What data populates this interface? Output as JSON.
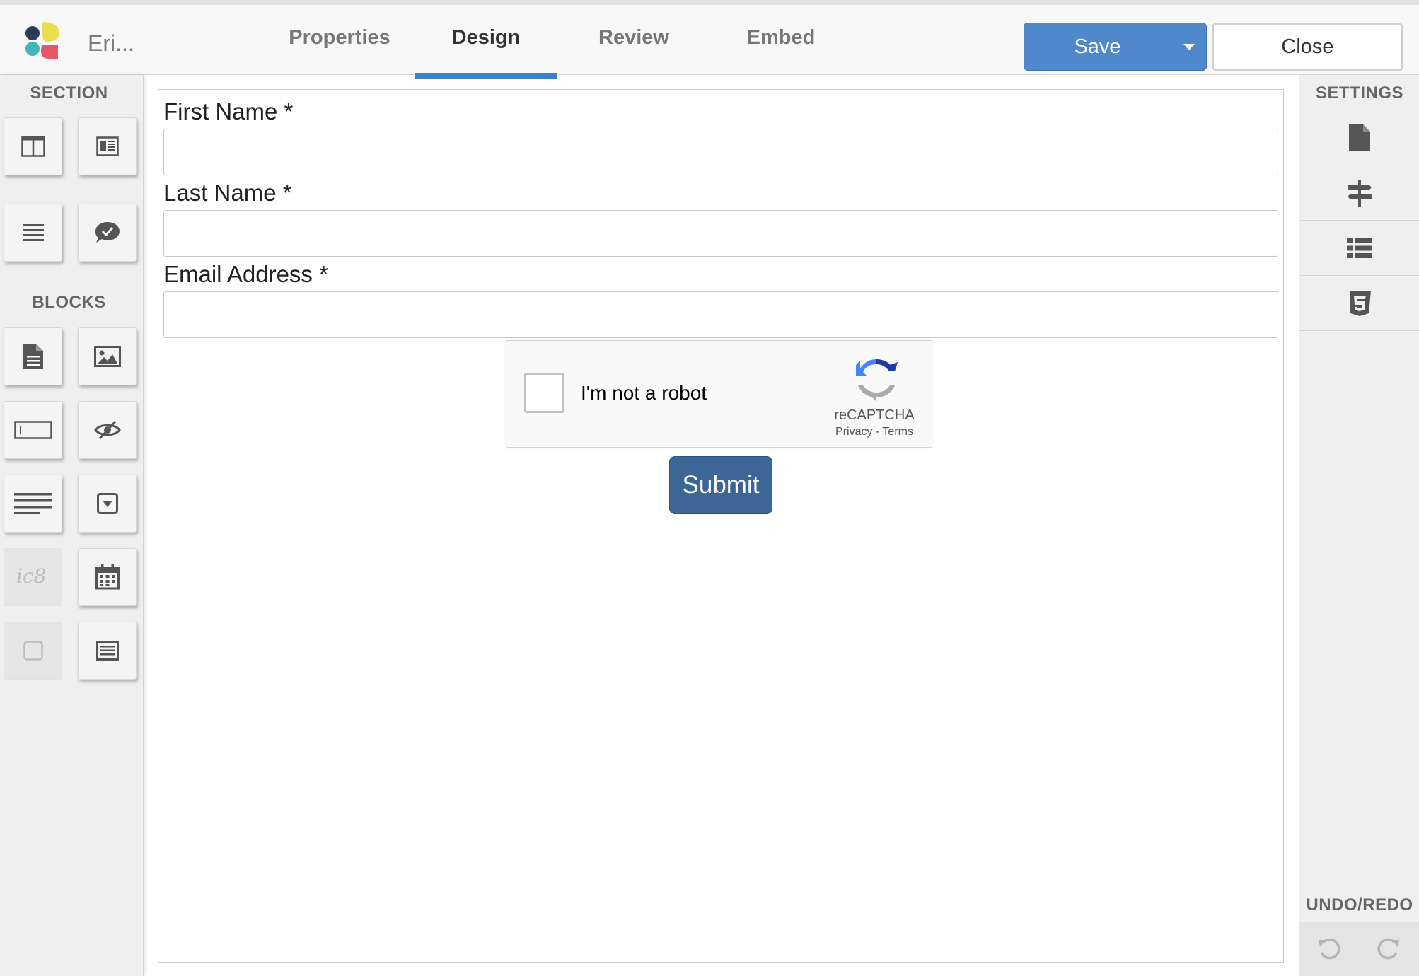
{
  "app": {
    "name": "Eri..."
  },
  "tabs": [
    {
      "label": "Properties",
      "active": false
    },
    {
      "label": "Design",
      "active": true
    },
    {
      "label": "Review",
      "active": false
    },
    {
      "label": "Embed",
      "active": false
    }
  ],
  "toolbar": {
    "save_label": "Save",
    "close_label": "Close"
  },
  "left_panel": {
    "section_heading": "SECTION",
    "blocks_heading": "BLOCKS",
    "section_tools": [
      "two-column-layout-icon",
      "image-text-layout-icon",
      "list-layout-icon",
      "feedback-bubble-icon"
    ],
    "block_tools": [
      "document-icon",
      "image-icon",
      "text-input-icon",
      "hidden-eye-icon",
      "paragraph-icon",
      "dropdown-icon",
      "signature-icon",
      "calendar-icon",
      "checkbox-icon",
      "textarea-icon"
    ]
  },
  "form": {
    "fields": [
      {
        "label": "First Name *",
        "value": ""
      },
      {
        "label": "Last Name *",
        "value": ""
      },
      {
        "label": "Email Address *",
        "value": ""
      }
    ],
    "recaptcha": {
      "label": "I'm not a robot",
      "brand": "reCAPTCHA",
      "links": "Privacy - Terms"
    },
    "submit_label": "Submit"
  },
  "right_panel": {
    "settings_heading": "SETTINGS",
    "undo_redo_heading": "UNDO/REDO",
    "settings_items": [
      "page-settings-icon",
      "signpost-icon",
      "list-settings-icon",
      "css3-icon"
    ]
  },
  "colors": {
    "accent": "#3a83c5",
    "save_button": "#4f88cb",
    "submit_button": "#3b6696",
    "panel_bg": "#efefef"
  }
}
